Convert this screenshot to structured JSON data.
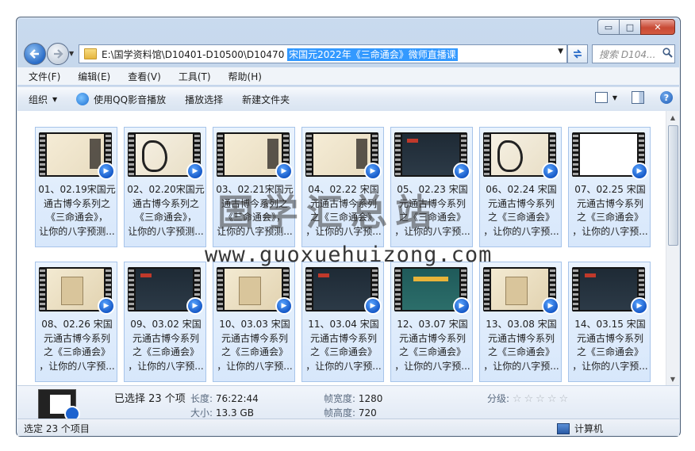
{
  "window": {
    "caption_buttons": {
      "minimize": "▭",
      "maximize": "□",
      "close": "✕"
    }
  },
  "nav": {
    "path_prefix": "E:\\国学资料馆\\D10401-D10500\\D10470",
    "path_selected": "宋国元2022年《三命通会》微师直播课",
    "search_placeholder": "搜索 D104...",
    "icons": {
      "back": "arrow-left-icon",
      "forward": "arrow-right-icon",
      "refresh": "refresh-icon",
      "search": "magnifier-icon"
    }
  },
  "menu": [
    "文件(F)",
    "编辑(E)",
    "查看(V)",
    "工具(T)",
    "帮助(H)"
  ],
  "toolbar": {
    "organize": "组织",
    "qq_play": "使用QQ影音播放",
    "play_selection": "播放选择",
    "new_folder": "新建文件夹"
  },
  "files": [
    {
      "line1": "01、02.19宋国元",
      "line2": "通古博今系列之",
      "line3": "《三命通会》，",
      "line4": "让你的八字预测...",
      "thumb": "cream"
    },
    {
      "line1": "02、02.20宋国元",
      "line2": "通古博今系列之",
      "line3": "《三命通会》，",
      "line4": "让你的八字预测...",
      "thumb": "ink"
    },
    {
      "line1": "03、02.21宋国元",
      "line2": "通古博今系列之",
      "line3": "《三命通会》，",
      "line4": "让你的八字预测...",
      "thumb": "cream"
    },
    {
      "line1": "04、02.22 宋国",
      "line2": "元通古博今系列",
      "line3": "之《三命通会》",
      "line4": "，让你的八字预...",
      "thumb": "cream"
    },
    {
      "line1": "05、02.23 宋国",
      "line2": "元通古博今系列",
      "line3": "之《三命通会》",
      "line4": "，让你的八字预...",
      "thumb": "dark"
    },
    {
      "line1": "06、02.24 宋国",
      "line2": "元通古博今系列",
      "line3": "之《三命通会》",
      "line4": "，让你的八字预...",
      "thumb": "ink"
    },
    {
      "line1": "07、02.25 宋国",
      "line2": "元通古博今系列",
      "line3": "之《三命通会》",
      "line4": "，让你的八字预...",
      "thumb": "white"
    },
    {
      "line1": "08、02.26 宋国",
      "line2": "元通古博今系列",
      "line3": "之《三命通会》",
      "line4": "，让你的八字预...",
      "thumb": "book"
    },
    {
      "line1": "09、03.02 宋国",
      "line2": "元通古博今系列",
      "line3": "之《三命通会》",
      "line4": "，让你的八字预...",
      "thumb": "dark"
    },
    {
      "line1": "10、03.03 宋国",
      "line2": "元通古博今系列",
      "line3": "之《三命通会》",
      "line4": "，让你的八字预...",
      "thumb": "book"
    },
    {
      "line1": "11、03.04 宋国",
      "line2": "元通古博今系列",
      "line3": "之《三命通会》",
      "line4": "，让你的八字预...",
      "thumb": "dark"
    },
    {
      "line1": "12、03.07 宋国",
      "line2": "元通古博今系列",
      "line3": "之《三命通会》",
      "line4": "，让你的八字预...",
      "thumb": "teal"
    },
    {
      "line1": "13、03.08 宋国",
      "line2": "元通古博今系列",
      "line3": "之《三命通会》",
      "line4": "，让你的八字预...",
      "thumb": "book"
    },
    {
      "line1": "14、03.15 宋国",
      "line2": "元通古博今系列",
      "line3": "之《三命通会》",
      "line4": "，让你的八字预...",
      "thumb": "dark"
    }
  ],
  "details": {
    "selected_count": "已选择 23 个项",
    "length_label": "长度:",
    "length_value": "76:22:44",
    "size_label": "大小:",
    "size_value": "13.3 GB",
    "frame_width_label": "帧宽度:",
    "frame_width_value": "1280",
    "frame_height_label": "帧高度:",
    "frame_height_value": "720",
    "rating_label": "分级:",
    "rating_stars": "☆☆☆☆☆"
  },
  "status": {
    "selected_items": "选定 23 个项目",
    "location": "计算机"
  },
  "watermark": {
    "text": "国学汇总站",
    "url": "www.guoxuehuizong.com"
  }
}
